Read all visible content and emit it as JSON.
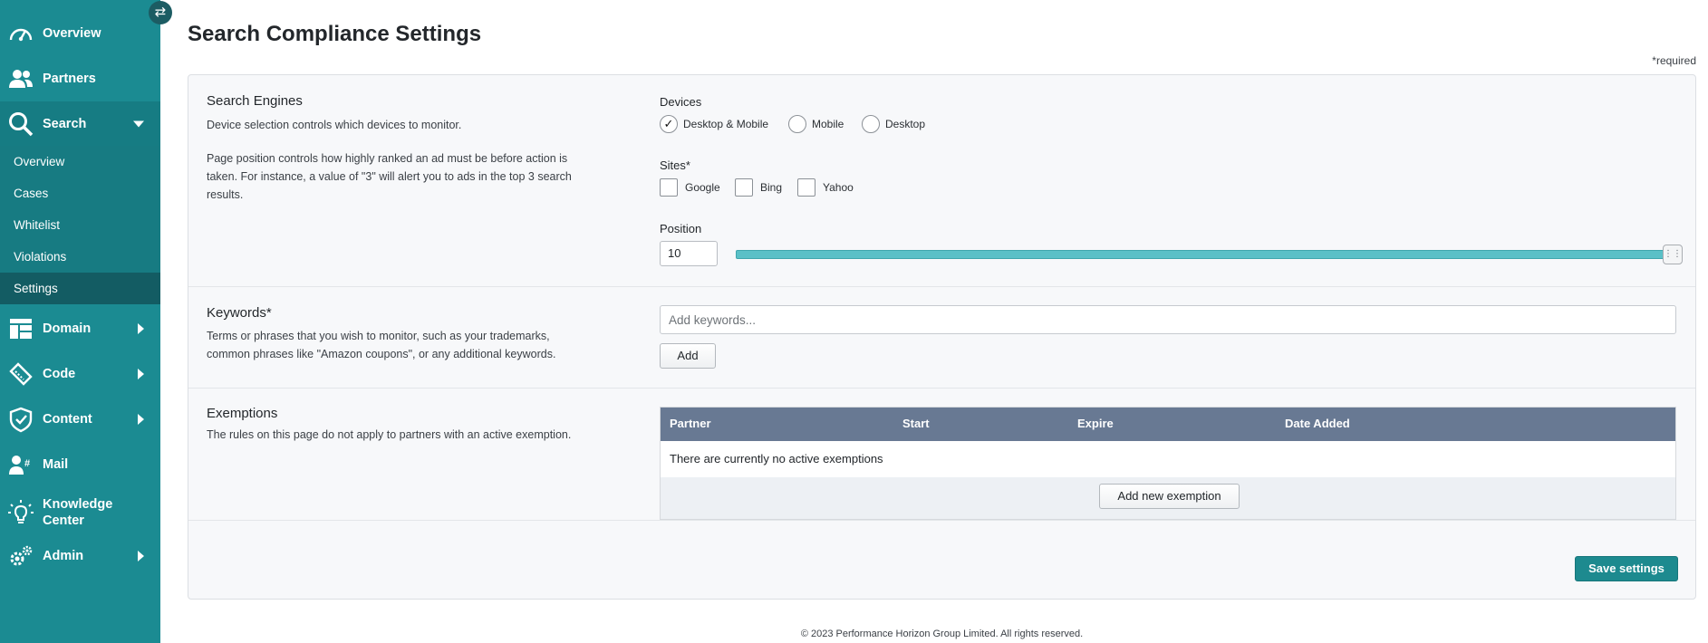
{
  "sidebar": {
    "toggle_icon": "swap-arrows-icon",
    "nav": {
      "overview": "Overview",
      "partners": "Partners",
      "search": "Search",
      "domain": "Domain",
      "code": "Code",
      "content": "Content",
      "mail": "Mail",
      "knowledge_line1": "Knowledge",
      "knowledge_line2": "Center",
      "admin": "Admin"
    },
    "search_sub": {
      "overview": "Overview",
      "cases": "Cases",
      "whitelist": "Whitelist",
      "violations": "Violations",
      "settings": "Settings"
    },
    "active_sub": "Settings"
  },
  "page": {
    "title": "Search Compliance Settings",
    "required_note": "*required"
  },
  "search_engines": {
    "title": "Search Engines",
    "desc1": "Device selection controls which devices to monitor.",
    "desc2": "Page position controls how highly ranked an ad must be before action is taken. For instance, a value of \"3\" will alert you to ads in the top 3 search results.",
    "devices_label": "Devices",
    "devices": {
      "desktop_mobile": "Desktop & Mobile",
      "mobile": "Mobile",
      "desktop": "Desktop"
    },
    "selected_device": "Desktop & Mobile",
    "sites_label": "Sites*",
    "sites": {
      "google": "Google",
      "bing": "Bing",
      "yahoo": "Yahoo"
    },
    "position_label": "Position",
    "position_value": "10"
  },
  "keywords": {
    "title": "Keywords*",
    "desc": "Terms or phrases that you wish to monitor, such as your trademarks, common phrases like \"Amazon coupons\", or any additional keywords.",
    "placeholder": "Add keywords...",
    "add_label": "Add"
  },
  "exemptions": {
    "title": "Exemptions",
    "desc": "The rules on this page do not apply to partners with an active exemption.",
    "columns": {
      "partner": "Partner",
      "start": "Start",
      "expire": "Expire",
      "date_added": "Date Added"
    },
    "empty_text": "There are currently no active exemptions",
    "add_label": "Add new exemption"
  },
  "actions": {
    "save_label": "Save settings"
  },
  "footer": {
    "text": "© 2023 Performance Horizon Group Limited. All rights reserved."
  },
  "colors": {
    "sidebar": "#1b8b92",
    "table_header": "#687993",
    "primary_button": "#1d8a8f",
    "slider": "#5ac0c7"
  }
}
